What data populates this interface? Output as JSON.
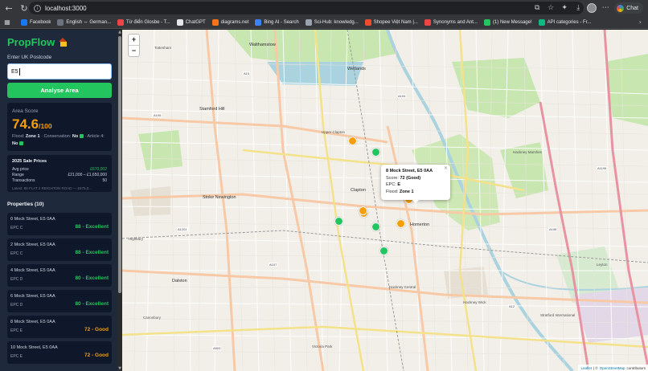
{
  "browser": {
    "url": "localhost:3000",
    "chat_label": "Chat",
    "bookmarks": [
      {
        "label": "Facebook",
        "color": "#1877f2"
      },
      {
        "label": "English ⇔ German...",
        "color": "#6b7280"
      },
      {
        "label": "Từ điển Glosbe - T...",
        "color": "#ef4444"
      },
      {
        "label": "ChatGPT",
        "color": "#e5e7eb"
      },
      {
        "label": "diagrams.net",
        "color": "#f97316"
      },
      {
        "label": "Bing AI - Search",
        "color": "#3b82f6"
      },
      {
        "label": "Sci-Hub: knowledg...",
        "color": "#9ca3af"
      },
      {
        "label": "Shopee Việt Nam |...",
        "color": "#ee4d2d"
      },
      {
        "label": "Synonyms and Ant...",
        "color": "#ef4444"
      },
      {
        "label": "(1) New Message!",
        "color": "#22c55e"
      },
      {
        "label": "API categories - Fr...",
        "color": "#10b981"
      }
    ]
  },
  "app": {
    "title": "PropFlow",
    "postcode_label": "Enter UK Postcode",
    "postcode_value": "E5",
    "analyse_button": "Analyse Area",
    "area_score": {
      "label": "Area Score",
      "value": "74.6",
      "denominator": "/100",
      "flood_label": "Flood:",
      "flood_value": "Zone 1",
      "conservation_label": "Conservation:",
      "conservation_value": "No",
      "article4_label": "Article 4:",
      "article4_value": "No"
    },
    "sale_prices": {
      "title": "2025 Sale Prices",
      "avg_label": "Avg price",
      "avg_value": "£670,002",
      "range_label": "Range",
      "range_value": "£21,000 – £1,650,000",
      "transactions_label": "Transactions",
      "transactions_value": "50",
      "latest": "Latest: 86 FLAT 2 REIGHTON ROAD — £875,0..."
    },
    "properties_title": "Properties (10)",
    "properties": [
      {
        "address": "0 Mock Street, E5 0AA",
        "epc": "EPC C",
        "score": "88 - Excellent",
        "color": "#22c55e"
      },
      {
        "address": "2 Mock Street, E5 0AA",
        "epc": "EPC C",
        "score": "88 - Excellent",
        "color": "#22c55e"
      },
      {
        "address": "4 Mock Street, E5 0AA",
        "epc": "EPC D",
        "score": "80 - Excellent",
        "color": "#22c55e"
      },
      {
        "address": "6 Mock Street, E5 0AA",
        "epc": "EPC D",
        "score": "80 - Excellent",
        "color": "#22c55e"
      },
      {
        "address": "8 Mock Street, E5 0AA",
        "epc": "EPC E",
        "score": "72 - Good",
        "color": "#f59e0b"
      },
      {
        "address": "10 Mock Street, E5 0AA",
        "epc": "EPC E",
        "score": "72 - Good",
        "color": "#f59e0b"
      }
    ]
  },
  "map": {
    "zoom_in": "+",
    "zoom_out": "−",
    "popup": {
      "title": "8 Mock Street, E5 0AA",
      "score_label": "Score:",
      "score_value": "72 (Good)",
      "epc_label": "EPC:",
      "epc_value": "E",
      "flood_label": "Flood:",
      "flood_value": "Zone 1",
      "close": "×"
    },
    "places": [
      {
        "text": "Walthamstow",
        "big": true
      },
      {
        "text": "Wetlands",
        "big": true
      },
      {
        "text": "Tottenham",
        "big": false
      },
      {
        "text": "Stamford Hill",
        "big": true
      },
      {
        "text": "Upper Clapton",
        "big": false
      },
      {
        "text": "Stoke Newington",
        "big": true
      },
      {
        "text": "Clapton",
        "big": true
      },
      {
        "text": "Hackney Marshes",
        "big": false
      },
      {
        "text": "Homerton",
        "big": true
      },
      {
        "text": "Hackney Central",
        "big": false
      },
      {
        "text": "Dalston",
        "big": true
      },
      {
        "text": "Hackney Wick",
        "big": false
      },
      {
        "text": "Canonbury",
        "big": false
      },
      {
        "text": "Highbury",
        "big": false
      },
      {
        "text": "Stratford International",
        "big": false
      },
      {
        "text": "Leyton",
        "big": false
      },
      {
        "text": "Victoria Park",
        "big": false
      }
    ],
    "road_labels": [
      "A10",
      "A107",
      "A104",
      "A1201",
      "A105",
      "A12",
      "A106",
      "A1199",
      "A503"
    ],
    "attribution_leaflet": "Leaflet",
    "attribution_sep": "| ©",
    "attribution_osm": "OpenStreetMap",
    "attribution_tail": "contributors",
    "markers": [
      {
        "status": "good",
        "color": "#f59e0b"
      },
      {
        "status": "excellent",
        "color": "#22c55e"
      },
      {
        "status": "good",
        "color": "#f59e0b"
      },
      {
        "status": "excellent",
        "color": "#22c55e"
      },
      {
        "status": "good",
        "color": "#f59e0b"
      },
      {
        "status": "excellent",
        "color": "#22c55e"
      },
      {
        "status": "excellent",
        "color": "#22c55e"
      },
      {
        "status": "good",
        "color": "#f59e0b"
      },
      {
        "status": "excellent",
        "color": "#22c55e"
      },
      {
        "status": "good",
        "color": "#f59e0b"
      }
    ]
  }
}
